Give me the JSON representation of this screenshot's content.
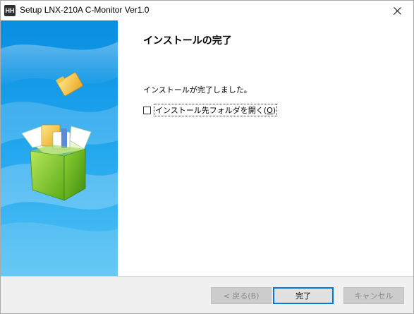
{
  "window": {
    "title": "Setup LNX-210A C-Monitor Ver1.0",
    "app_icon_text": "HH"
  },
  "content": {
    "heading": "インストールの完了",
    "message": "インストールが完了しました。",
    "checkbox": {
      "label_prefix": "インストール先フォルダを開く(",
      "mnemonic": "O",
      "label_suffix": ")",
      "checked": false
    }
  },
  "buttons": {
    "back": "< 戻る(B)",
    "finish": "完了",
    "cancel": "キャンセル"
  },
  "colors": {
    "accent": "#0078d7",
    "side_gradient_top": "#0a8ee0",
    "side_gradient_bottom": "#5cc8f5",
    "box_green": "#7cc828",
    "folder_yellow": "#f5c342"
  },
  "icons": {
    "close": "close-icon",
    "side": "software-box-icon"
  }
}
